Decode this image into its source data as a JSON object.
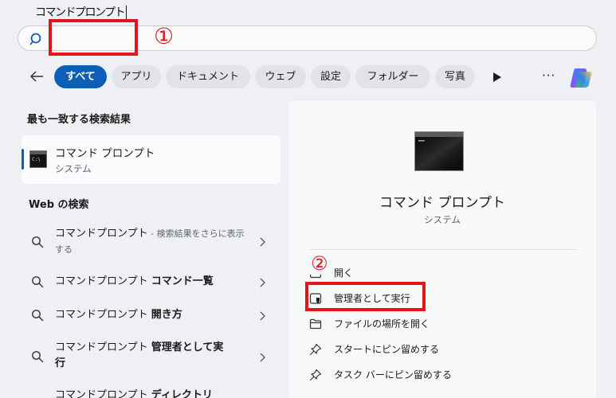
{
  "search": {
    "query": "コマンドプロンプト"
  },
  "annotations": {
    "step1": "①",
    "step2": "②"
  },
  "filters": {
    "items": [
      "すべて",
      "アプリ",
      "ドキュメント",
      "ウェブ",
      "設定",
      "フォルダー",
      "写真"
    ],
    "active": "すべて",
    "more": "···"
  },
  "left": {
    "best_match_heading": "最も一致する検索結果",
    "best_match": {
      "title": "コマンド プロンプト",
      "subtitle": "システム"
    },
    "web_heading": "Web の検索",
    "web_results": [
      {
        "query": "コマンドプロンプト",
        "note": " - 検索結果をさらに表示する",
        "suffix": ""
      },
      {
        "query": "コマンドプロンプト ",
        "note": "",
        "suffix": "コマンド一覧"
      },
      {
        "query": "コマンドプロンプト ",
        "note": "",
        "suffix": "開き方"
      },
      {
        "query": "コマンドプロンプト ",
        "note": "",
        "suffix": "管理者として実行"
      },
      {
        "query": "コマンドプロンプト ",
        "note": "",
        "suffix": "ディレクトリ"
      }
    ]
  },
  "preview": {
    "title": "コマンド プロンプト",
    "subtitle": "システム",
    "actions": [
      {
        "label": "開く",
        "icon": "open-icon"
      },
      {
        "label": "管理者として実行",
        "icon": "shield-icon"
      },
      {
        "label": "ファイルの場所を開く",
        "icon": "folder-icon"
      },
      {
        "label": "スタートにピン留めする",
        "icon": "pin-icon"
      },
      {
        "label": "タスク バーにピン留めする",
        "icon": "pin-icon"
      }
    ]
  },
  "colors": {
    "accent": "#0d5fb6",
    "annotation_red": "#e3141b",
    "background": "#eef0f3"
  }
}
